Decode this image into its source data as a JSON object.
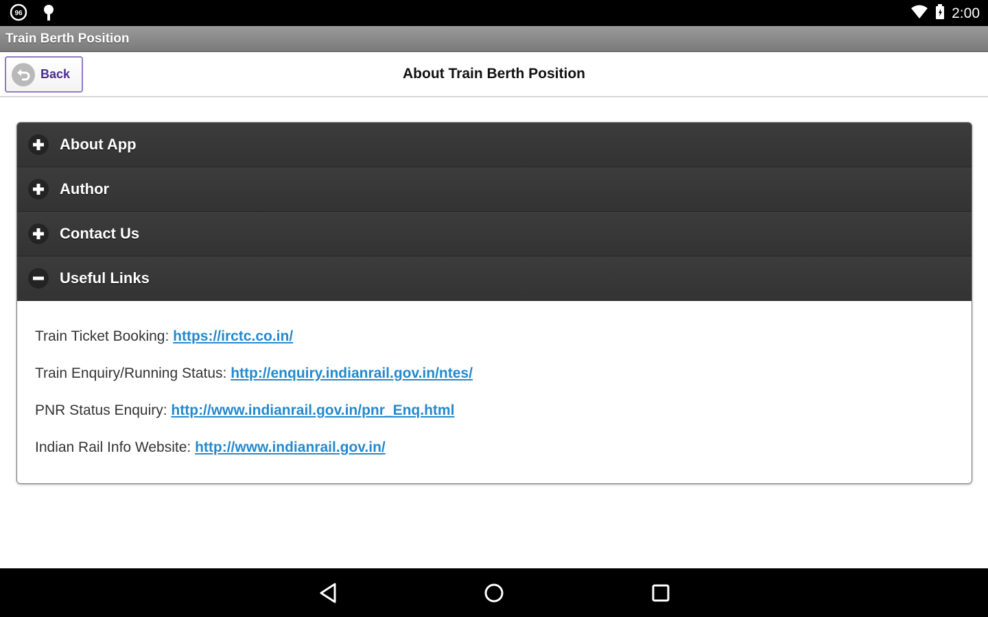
{
  "status_bar": {
    "left_icons": [
      "sync-badge-icon",
      "usb-debug-icon"
    ],
    "right_icons": [
      "wifi-icon",
      "battery-icon"
    ],
    "time": "2:00"
  },
  "app_bar": {
    "title": "Train Berth Position"
  },
  "header": {
    "back_label": "Back",
    "title": "About Train Berth Position"
  },
  "sections": [
    {
      "label": "About App",
      "expanded": false
    },
    {
      "label": "Author",
      "expanded": false
    },
    {
      "label": "Contact Us",
      "expanded": false
    },
    {
      "label": "Useful Links",
      "expanded": true
    }
  ],
  "useful_links": [
    {
      "label": "Train Ticket Booking: ",
      "url": "https://irctc.co.in/"
    },
    {
      "label": "Train Enquiry/Running Status: ",
      "url": "http://enquiry.indianrail.gov.in/ntes/"
    },
    {
      "label": "PNR Status Enquiry: ",
      "url": "http://www.indianrail.gov.in/pnr_Enq.html"
    },
    {
      "label": "Indian Rail Info Website: ",
      "url": "http://www.indianrail.gov.in/"
    }
  ],
  "nav_bar": {
    "icons": [
      "back-nav-icon",
      "home-nav-icon",
      "recents-nav-icon"
    ]
  },
  "colors": {
    "link": "#2489ce",
    "back_label": "#4b2d8c",
    "collapsible_header": "#333333"
  }
}
